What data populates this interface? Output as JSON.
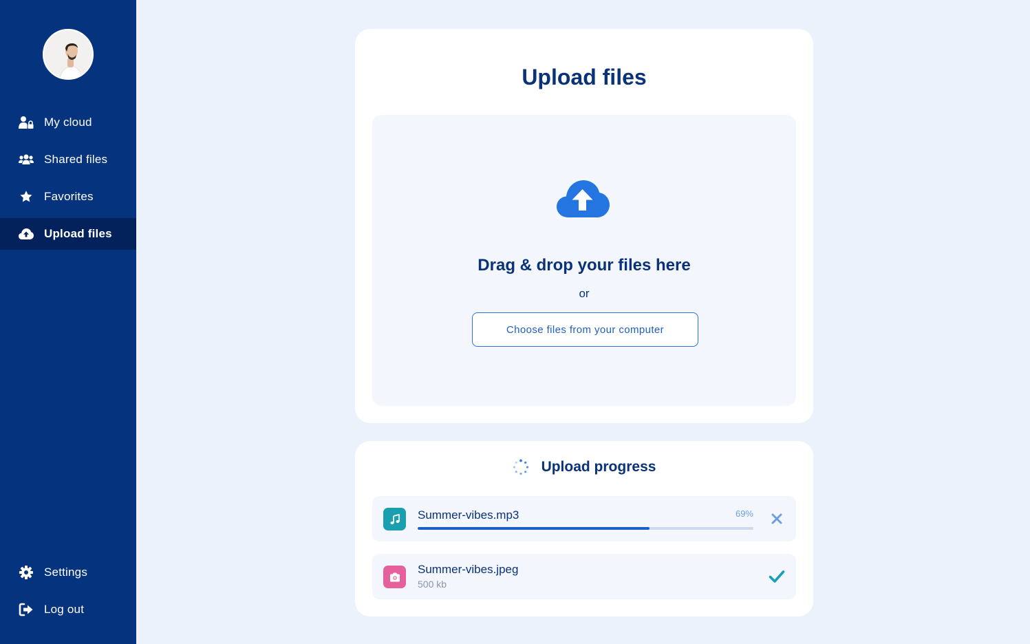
{
  "sidebar": {
    "items": [
      {
        "label": "My cloud",
        "icon": "user-lock-icon"
      },
      {
        "label": "Shared files",
        "icon": "users-icon"
      },
      {
        "label": "Favorites",
        "icon": "star-icon"
      },
      {
        "label": "Upload files",
        "icon": "cloud-upload-icon",
        "active": true
      }
    ],
    "bottom_items": [
      {
        "label": "Settings",
        "icon": "gear-icon"
      },
      {
        "label": "Log out",
        "icon": "logout-icon"
      }
    ]
  },
  "upload": {
    "title": "Upload files",
    "drop_title": "Drag & drop your files here",
    "or_label": "or",
    "choose_button": "Choose files from your computer"
  },
  "progress": {
    "title": "Upload progress",
    "files": [
      {
        "name": "Summer-vibes.mp3",
        "percent_label": "69%",
        "progress": 0.69,
        "type_icon": "music-icon",
        "status": "uploading"
      },
      {
        "name": "Summer-vibes.jpeg",
        "size": "500 kb",
        "type_icon": "camera-icon",
        "status": "done"
      }
    ]
  },
  "colors": {
    "sidebar": "#06337e",
    "sidebar_active": "#03215a",
    "accent": "#1e5fc4",
    "heading": "#0a3278",
    "page_bg": "#ebf2fc",
    "music_icon_bg": "#1a9fb0",
    "photo_icon_bg": "#e5609c"
  }
}
